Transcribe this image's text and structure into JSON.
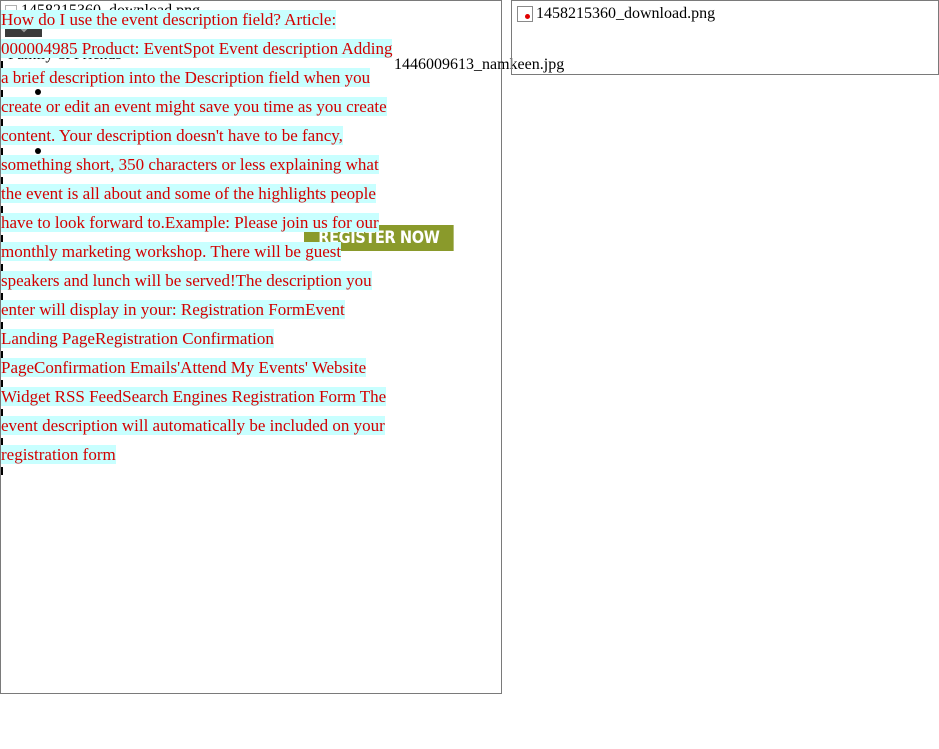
{
  "left_panel": {
    "image_alt_1": "1458215360_download.png",
    "family_label": "Family & Friends",
    "register_button_label": "REGISTER NOW",
    "image_alt_2": "1446009613_namkeen.jpg",
    "article_text": "How do I use the event description field? Article: 000004985 Product: EventSpot Event description Adding a brief description into the Description field when you create or edit an event might save you time as you create content. Your description doesn't have to be fancy, something short, 350 characters or less explaining what the event is all about and some of the highlights people have to look forward to.Example: Please join us for our monthly marketing workshop. There will be guest speakers and lunch will be served!The description you enter will display in your: Registration FormEvent Landing PageRegistration Confirmation PageConfirmation Emails'Attend My Events' Website Widget RSS FeedSearch Engines Registration Form The event description will automatically be included on your registration form"
  },
  "right_panel": {
    "broken_image_icon": "broken-image-icon",
    "image_alt": "1458215360_download.png"
  },
  "colors": {
    "article_text": "#d40000",
    "article_highlight": "#c8ffff",
    "register_button": "#8a9a2b",
    "dark_button": "#3b3b3b"
  }
}
